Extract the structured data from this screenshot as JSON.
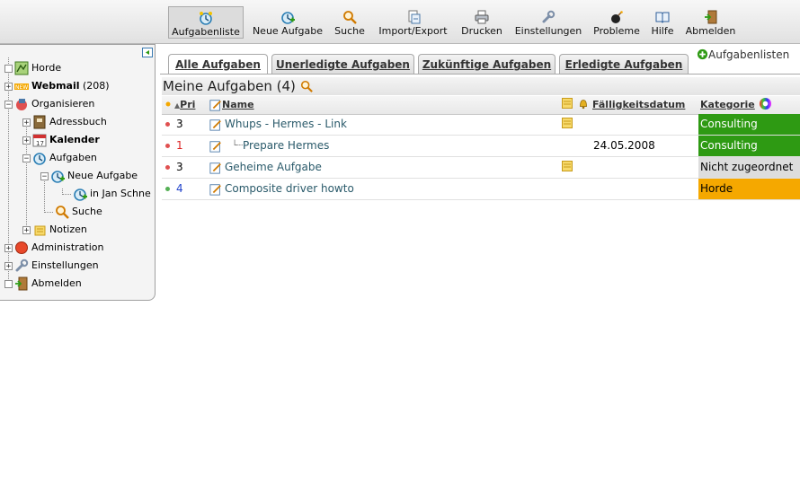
{
  "toolbar": {
    "items": [
      {
        "label": "Aufgabenliste",
        "icon": "clock-list-icon",
        "active": true
      },
      {
        "label": "Neue Aufgabe",
        "icon": "new-task-icon"
      },
      {
        "label": "Suche",
        "icon": "search-icon"
      },
      {
        "label": "Import/Export",
        "icon": "import-export-icon"
      },
      {
        "label": "Drucken",
        "icon": "printer-icon"
      },
      {
        "label": "Einstellungen",
        "icon": "wrench-icon"
      },
      {
        "label": "Probleme",
        "icon": "bomb-icon"
      },
      {
        "label": "Hilfe",
        "icon": "book-icon"
      },
      {
        "label": "Abmelden",
        "icon": "logout-door-icon"
      }
    ]
  },
  "sidebar": {
    "items": [
      {
        "label": "Horde",
        "icon": "horde-logo-icon"
      },
      {
        "label": "Webmail",
        "count": "(208)",
        "icon": "new-mail-icon"
      },
      {
        "label": "Organisieren",
        "icon": "organize-icon"
      },
      {
        "label": "Adressbuch",
        "icon": "address-book-icon"
      },
      {
        "label": "Kalender",
        "icon": "calendar-icon"
      },
      {
        "label": "Aufgaben",
        "icon": "tasks-clock-icon"
      },
      {
        "label": "Neue Aufgabe",
        "icon": "new-task-icon"
      },
      {
        "label": "in Jan Schne",
        "icon": "new-task-icon"
      },
      {
        "label": "Suche",
        "icon": "search-icon"
      },
      {
        "label": "Notizen",
        "icon": "notes-icon"
      },
      {
        "label": "Administration",
        "icon": "administration-icon"
      },
      {
        "label": "Einstellungen",
        "icon": "wrench-icon"
      },
      {
        "label": "Abmelden",
        "icon": "logout-door-icon"
      }
    ]
  },
  "tabs": [
    {
      "label": "Alle Aufgaben",
      "active": true
    },
    {
      "label": "Unerledigte Aufgaben"
    },
    {
      "label": "Zukünftige Aufgaben"
    },
    {
      "label": "Erledigte Aufgaben"
    }
  ],
  "tasklists_link": "Aufgabenlisten",
  "list": {
    "title": "Meine Aufgaben (4)",
    "columns": {
      "pri": "Pri",
      "name": "Name",
      "due": "Fälligkeitsdatum",
      "category": "Kategorie"
    },
    "rows": [
      {
        "priority": "3",
        "name": "Whups - Hermes - Link",
        "due": "",
        "category": "Consulting",
        "has_desc": true,
        "completed": false,
        "dot_color": "#e05050",
        "pri_color": "#000000",
        "cat_bg": "#2e9a13",
        "cat_fg": "#ffffff"
      },
      {
        "priority": "1",
        "name": "Prepare Hermes",
        "due": "24.05.2008",
        "category": "Consulting",
        "has_desc": false,
        "completed": false,
        "dot_color": "#e05050",
        "pri_color": "#dd2222",
        "cat_bg": "#2e9a13",
        "cat_fg": "#ffffff"
      },
      {
        "priority": "3",
        "name": "Geheime Aufgabe",
        "due": "",
        "category": "Nicht zugeordnet",
        "has_desc": true,
        "completed": false,
        "dot_color": "#e05050",
        "pri_color": "#000000",
        "cat_bg": "#dddddd",
        "cat_fg": "#000000"
      },
      {
        "priority": "4",
        "name": "Composite driver howto",
        "due": "",
        "category": "Horde",
        "has_desc": false,
        "completed": true,
        "dot_color": "#55b055",
        "pri_color": "#2244cc",
        "cat_bg": "#f5a800",
        "cat_fg": "#000000"
      }
    ]
  }
}
